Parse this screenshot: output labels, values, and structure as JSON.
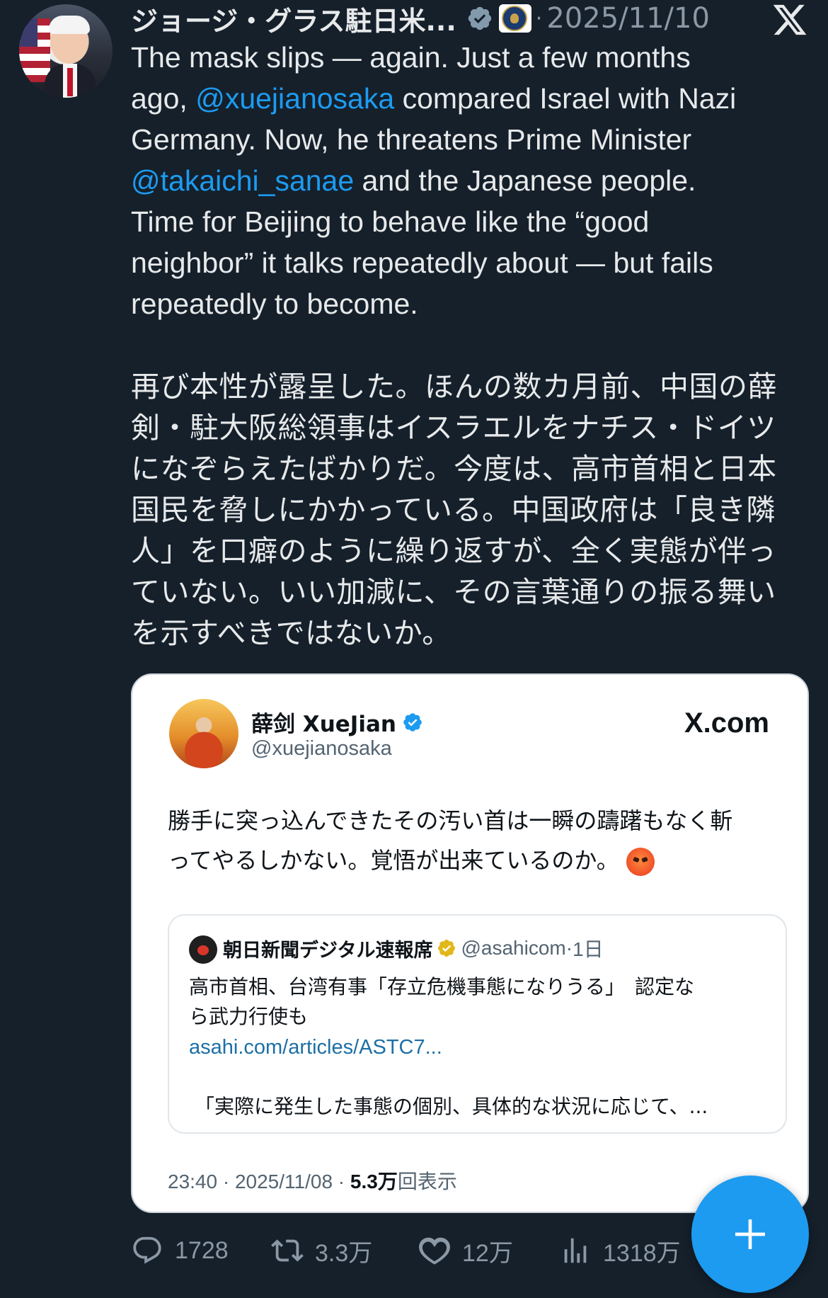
{
  "author": {
    "name": "ジョージ・グラス駐日米...",
    "date": "2025/11/10",
    "separator": "·"
  },
  "tweet": {
    "en_1": "The mask slips — again. Just a few months\nago, ",
    "mention_1": "@xuejianosaka",
    "en_2": " compared Israel with Nazi\nGermany. Now, he threatens Prime Minister\n",
    "mention_2": "@takaichi_sanae",
    "en_3": " and the Japanese people.\nTime for Beijing to behave like the “good\nneighbor” it talks repeatedly about — but fails\nrepeatedly to become.",
    "jp": "再び本性が露呈した。ほんの数カ月前、中国の薛\n剣・駐大阪総領事はイスラエルをナチス・ドイツ\nになぞらえたばかりだ。今度は、高市首相と日本\n国民を脅しにかかっている。中国政府は「良き隣\n人」を口癖のように繰り返すが、全く実態が伴っ\nていない。いい加減に、その言葉通りの振る舞い\nを示すべきではないか。"
  },
  "embedded": {
    "name": "薛剑 XueJian",
    "handle": "@xuejianosaka",
    "source": "X.com",
    "text": "勝手に突っ込んできたその汚い首は一瞬の躊躇もなく斬\nってやるしかない。覚悟が出来ているのか。",
    "quote": {
      "name": "朝日新聞デジタル速報席",
      "handle": "@asahicom",
      "time": "1日",
      "body": "高市首相、台湾有事「存立危機事態になりうる」　認定な\nら武力行使も",
      "link": "asahi.com/articles/ASTC7...",
      "excerpt": "「実際に発生した事態の個別、具体的な状況に応じて、..."
    },
    "meta_time": "23:40",
    "meta_date": "2025/11/08",
    "meta_views_count": "5.3万",
    "meta_views_label": "回表示"
  },
  "actions": {
    "replies": "1728",
    "reposts": "3.3万",
    "likes": "12万",
    "views": "1318万"
  },
  "colors": {
    "background": "#15202b",
    "accent": "#1d9bf0",
    "muted": "#8b98a5"
  },
  "icons": [
    "verified-badge-icon",
    "state-department-seal-icon",
    "x-logo-icon",
    "reply-icon",
    "repost-icon",
    "like-icon",
    "views-icon",
    "compose-plus-icon"
  ]
}
